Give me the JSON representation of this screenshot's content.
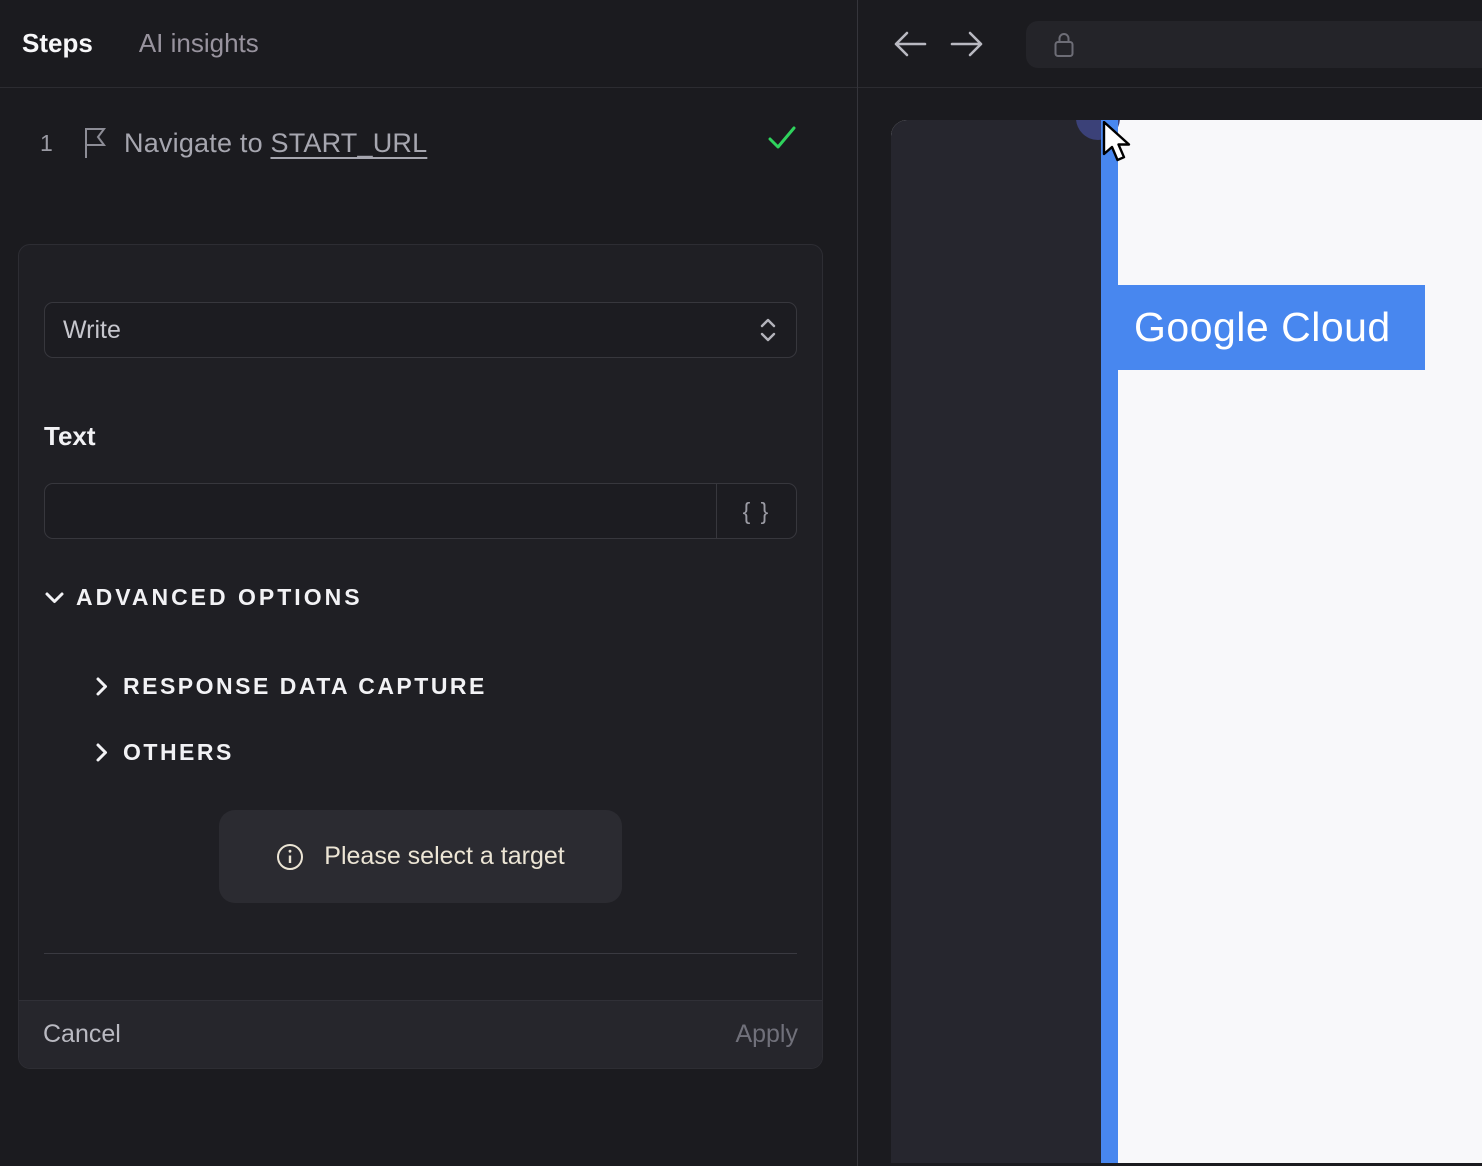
{
  "left_panel": {
    "tabs": [
      {
        "label": "Steps",
        "active": true
      },
      {
        "label": "AI insights",
        "active": false
      }
    ],
    "step": {
      "number": "1",
      "action": "Navigate to ",
      "target": "START_URL",
      "status": "success"
    },
    "form": {
      "action_select": {
        "value": "Write"
      },
      "text_field": {
        "label": "Text",
        "value": ""
      },
      "variable_button_label": "{ }",
      "advanced_options_label": "ADVANCED OPTIONS",
      "sections": [
        {
          "label": "RESPONSE DATA CAPTURE",
          "expanded": false
        },
        {
          "label": "OTHERS",
          "expanded": false
        }
      ],
      "hint": "Please select a target",
      "cancel_label": "Cancel",
      "apply_label": "Apply"
    }
  },
  "browser": {
    "address_value": "",
    "page": {
      "selection_text": "Google Cloud"
    }
  },
  "colors": {
    "accent_blue": "#4887ef",
    "success_green": "#2fd35d",
    "hint_text": "#ece5d5",
    "panel_bg": "#1b1b1f",
    "preview_sidebar": "#26262e",
    "page_bg": "#f8f8fa"
  }
}
